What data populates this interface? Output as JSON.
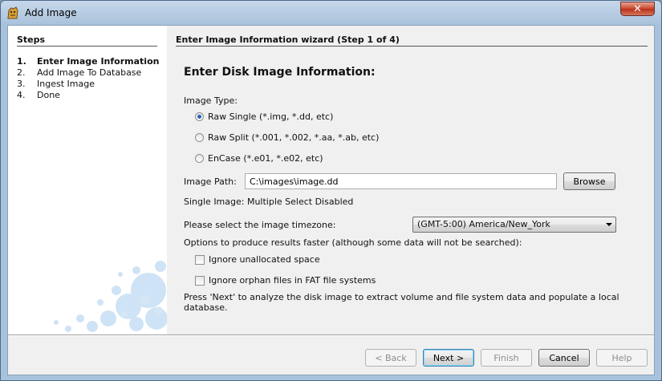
{
  "window": {
    "title": "Add Image"
  },
  "steps": {
    "title": "Steps",
    "items": [
      {
        "num": "1.",
        "label": "Enter Image Information",
        "active": true
      },
      {
        "num": "2.",
        "label": "Add Image To Database",
        "active": false
      },
      {
        "num": "3.",
        "label": "Ingest Image",
        "active": false
      },
      {
        "num": "4.",
        "label": "Done",
        "active": false
      }
    ]
  },
  "wizard": {
    "title": "Enter Image Information wizard (Step 1 of 4)",
    "heading": "Enter Disk Image Information:",
    "image_type_label": "Image Type:",
    "image_types": [
      {
        "label": "Raw Single (*.img, *.dd, etc)",
        "checked": true
      },
      {
        "label": "Raw Split (*.001, *.002, *.aa, *.ab, etc)",
        "checked": false
      },
      {
        "label": "EnCase (*.e01, *.e02, etc)",
        "checked": false
      }
    ],
    "image_path_label": "Image Path:",
    "image_path_value": "C:\\images\\image.dd",
    "browse_label": "Browse",
    "select_info": "Single Image: Multiple Select Disabled",
    "timezone_label": "Please select the image timezone:",
    "timezone_value": "(GMT-5:00) America/New_York",
    "options_label": "Options to produce results faster (although some data will not be searched):",
    "options": [
      {
        "label": "Ignore unallocated space",
        "checked": false
      },
      {
        "label": "Ignore orphan files in FAT file systems",
        "checked": false
      }
    ],
    "next_info": "Press 'Next' to analyze the disk image to extract volume and file system data and populate a local database."
  },
  "footer": {
    "back_label": "< Back",
    "next_label": "Next >",
    "finish_label": "Finish",
    "cancel_label": "Cancel",
    "help_label": "Help"
  },
  "colors": {
    "accent": "#2a63b8",
    "close": "#c9462c",
    "bubbles": "#a8cdef"
  }
}
